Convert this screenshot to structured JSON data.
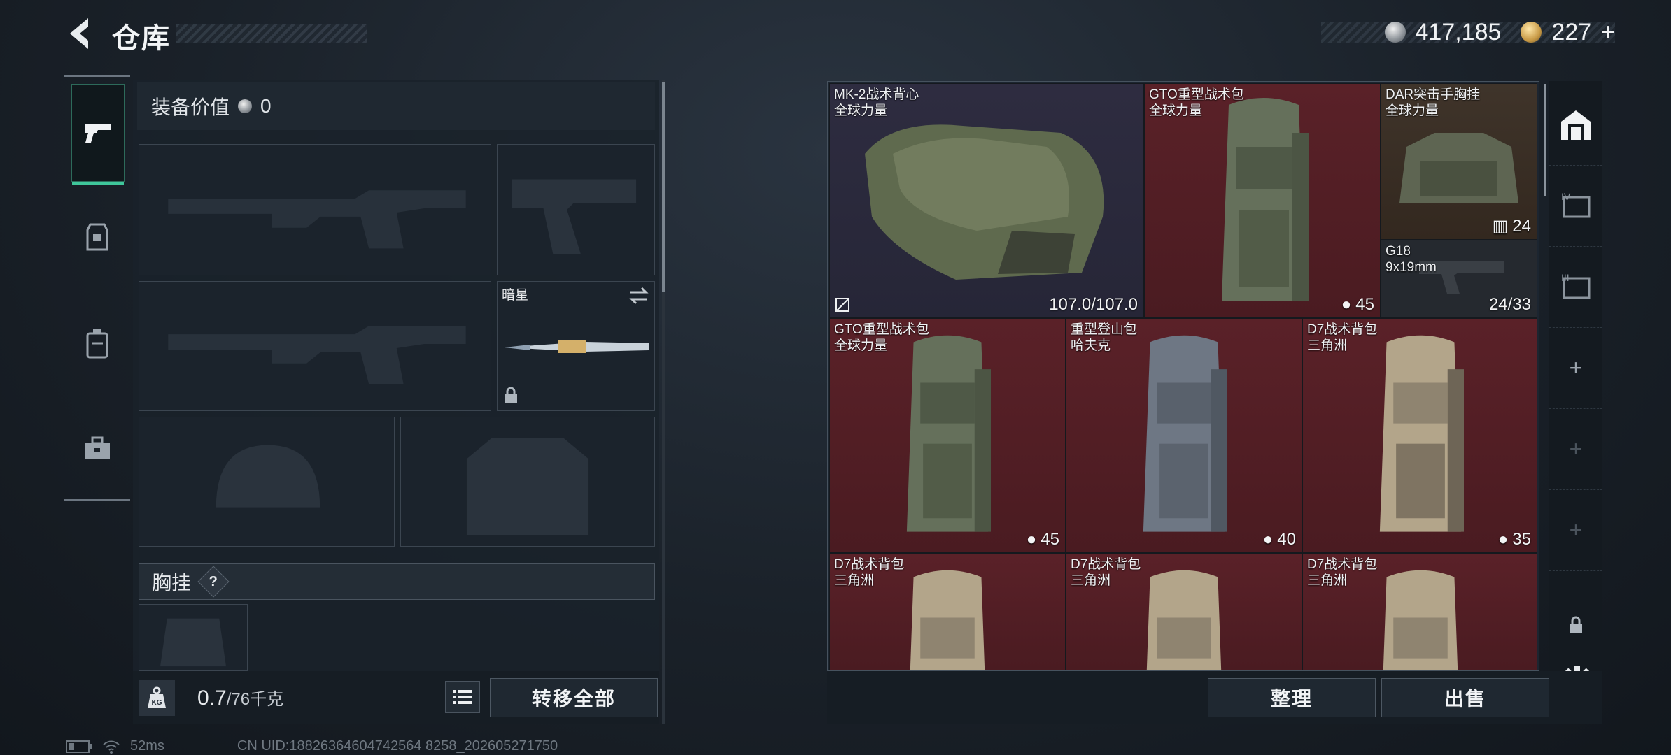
{
  "header": {
    "title": "仓库",
    "silver": "417,185",
    "gold": "227",
    "gold_plus": "+"
  },
  "loadout": {
    "value_label": "装备价值",
    "value": "0",
    "melee_name": "暗星",
    "chest_label": "胸挂",
    "help": "?",
    "weight_current": "0.7",
    "weight_max": "/76千克",
    "transfer_all": "转移全部"
  },
  "stash": {
    "items": [
      {
        "name": "MK-2战术背心\n全球力量",
        "value": "107.0/107.0",
        "color": "purple"
      },
      {
        "name": "GTO重型战术包\n全球力量",
        "value": "45",
        "color": "red"
      },
      {
        "name": "DAR突击手胸挂\n全球力量",
        "value": "24",
        "color": "brown"
      },
      {
        "name": "G18\n9x19mm",
        "value": "24/33",
        "color": "dark"
      },
      {
        "name": "GTO重型战术包\n全球力量",
        "value": "45",
        "color": "red"
      },
      {
        "name": "重型登山包\n哈夫克",
        "value": "40",
        "color": "red"
      },
      {
        "name": "D7战术背包\n三角洲",
        "value": "35",
        "color": "red"
      },
      {
        "name": "D7战术背包\n三角洲",
        "value": "",
        "color": "red"
      },
      {
        "name": "D7战术背包\n三角洲",
        "value": "",
        "color": "red"
      },
      {
        "name": "D7战术背包\n三角洲",
        "value": "",
        "color": "red"
      }
    ],
    "sort_label": "整理",
    "sell_label": "出售"
  },
  "status": {
    "ping": "52ms",
    "uid": "CN UID:18826364604742564 8258_202605271750"
  }
}
